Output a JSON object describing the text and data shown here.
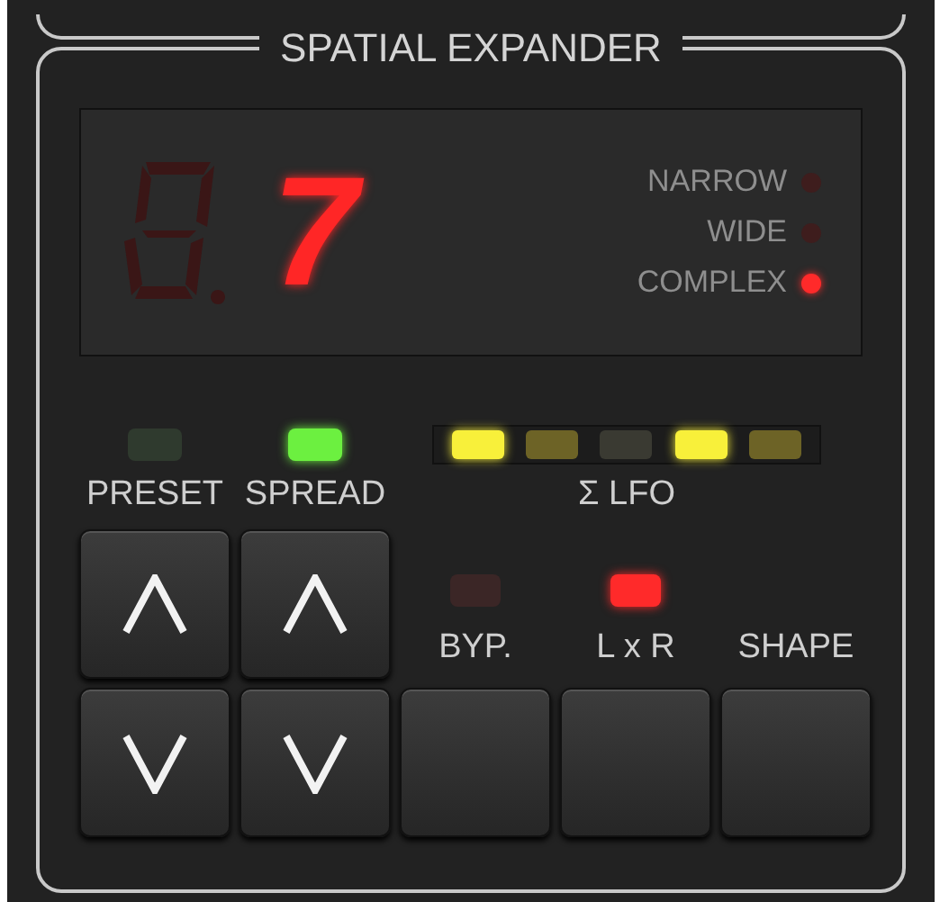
{
  "title": "SPATIAL EXPANDER",
  "display": {
    "value": "7"
  },
  "modes": [
    {
      "label": "NARROW",
      "selected": false
    },
    {
      "label": "WIDE",
      "selected": false
    },
    {
      "label": "COMPLEX",
      "selected": true
    }
  ],
  "indicators": [
    {
      "label": "PRESET",
      "on": false
    },
    {
      "label": "SPREAD",
      "on": true
    }
  ],
  "lfo": {
    "label": "Σ LFO",
    "leds": [
      {
        "on": true,
        "dim": false
      },
      {
        "on": false,
        "dim": true
      },
      {
        "on": false,
        "dim": false
      },
      {
        "on": true,
        "dim": false
      },
      {
        "on": false,
        "dim": true
      }
    ]
  },
  "switches": [
    {
      "kind": "led",
      "label": "BYP.",
      "on": false
    },
    {
      "kind": "led",
      "label": "L x R",
      "on": true
    },
    {
      "kind": "plain",
      "label": "SHAPE"
    }
  ]
}
